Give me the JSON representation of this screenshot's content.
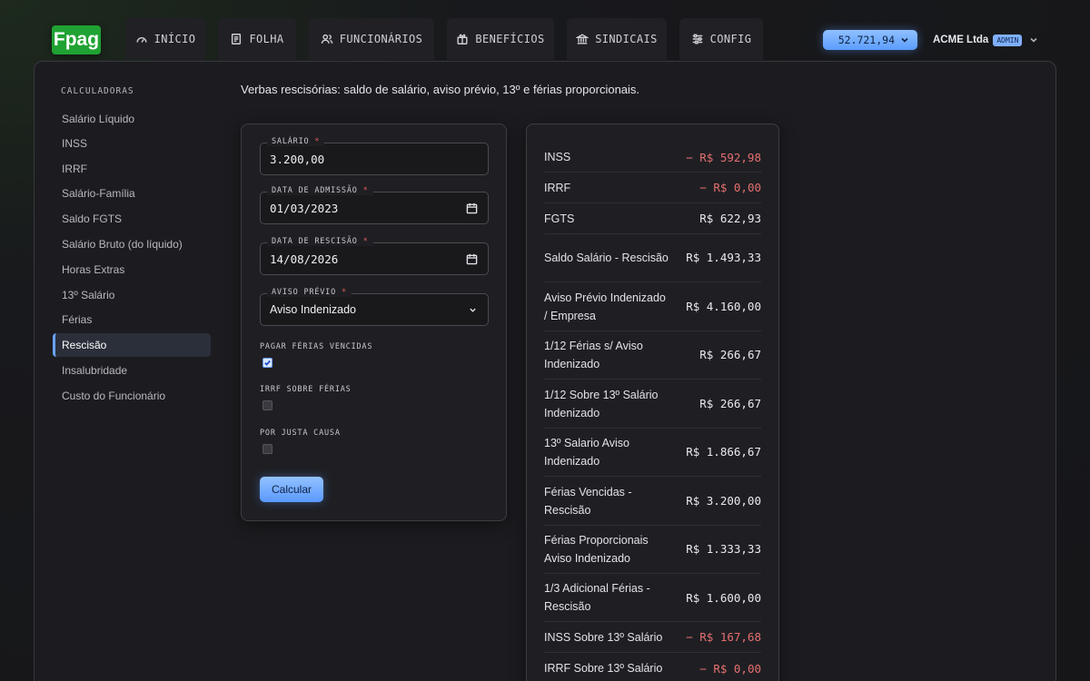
{
  "app": {
    "logo": "Fpag"
  },
  "nav": {
    "tabs": [
      {
        "label": "INÍCIO",
        "icon": "gauge-icon"
      },
      {
        "label": "FOLHA",
        "icon": "document-icon"
      },
      {
        "label": "FUNCIONÁRIOS",
        "icon": "users-icon"
      },
      {
        "label": "BENEFÍCIOS",
        "icon": "gift-icon"
      },
      {
        "label": "SINDICAIS",
        "icon": "bank-icon"
      },
      {
        "label": "CONFIG",
        "icon": "sliders-icon"
      }
    ],
    "balance": "52.721,94",
    "company": "ACME Ltda",
    "role_badge": "ADMIN"
  },
  "sidebar": {
    "heading": "CALCULADORAS",
    "items": [
      "Salário Líquido",
      "INSS",
      "IRRF",
      "Salário-Família",
      "Saldo FGTS",
      "Salário Bruto (do líquido)",
      "Horas Extras",
      "13º Salário",
      "Férias",
      "Rescisão",
      "Insalubridade",
      "Custo do Funcionário"
    ],
    "active": "Rescisão"
  },
  "main": {
    "description": "Verbas rescisórias: saldo de salário, aviso prévio, 13º e férias proporcionais."
  },
  "form": {
    "salario": {
      "label": "SALÁRIO",
      "value": "3.200,00"
    },
    "admissao": {
      "label": "DATA DE ADMISSÃO",
      "value": "01/03/2023"
    },
    "rescisao": {
      "label": "DATA DE RESCISÃO",
      "value": "14/08/2026"
    },
    "aviso": {
      "label": "AVISO PRÉVIO",
      "value": "Aviso Indenizado"
    },
    "required_mark": "*",
    "checkboxes": [
      {
        "label": "PAGAR FÉRIAS VENCIDAS",
        "checked": true
      },
      {
        "label": "IRRF SOBRE FÉRIAS",
        "checked": false
      },
      {
        "label": "POR JUSTA CAUSA",
        "checked": false
      }
    ],
    "submit_label": "Calcular"
  },
  "results": [
    {
      "label": "INSS",
      "value": "− R$ 592,98",
      "negative": true
    },
    {
      "label": "IRRF",
      "value": "− R$ 0,00",
      "negative": true
    },
    {
      "label": "FGTS",
      "value": "R$ 622,93",
      "negative": false
    },
    {
      "label": "Saldo Salário - Rescisão",
      "value": "R$ 1.493,33",
      "negative": false
    },
    {
      "label": "Aviso Prévio Indenizado / Empresa",
      "value": "R$ 4.160,00",
      "negative": false
    },
    {
      "label": "1/12 Férias s/ Aviso Indenizado",
      "value": "R$ 266,67",
      "negative": false
    },
    {
      "label": "1/12 Sobre 13º Salário Indenizado",
      "value": "R$ 266,67",
      "negative": false
    },
    {
      "label": "13º Salario Aviso Indenizado",
      "value": "R$ 1.866,67",
      "negative": false
    },
    {
      "label": "Férias Vencidas - Rescisão",
      "value": "R$ 3.200,00",
      "negative": false
    },
    {
      "label": "Férias Proporcionais Aviso Indenizado",
      "value": "R$ 1.333,33",
      "negative": false
    },
    {
      "label": "1/3 Adicional Férias - Rescisão",
      "value": "R$ 1.600,00",
      "negative": false
    },
    {
      "label": "INSS Sobre 13º Salário",
      "value": "− R$ 167,68",
      "negative": true
    },
    {
      "label": "IRRF Sobre 13º Salário",
      "value": "− R$ 0,00",
      "negative": true
    }
  ],
  "colors": {
    "accent": "#6aa3ff",
    "brand": "#1fa233",
    "negative": "#e46f6f"
  }
}
